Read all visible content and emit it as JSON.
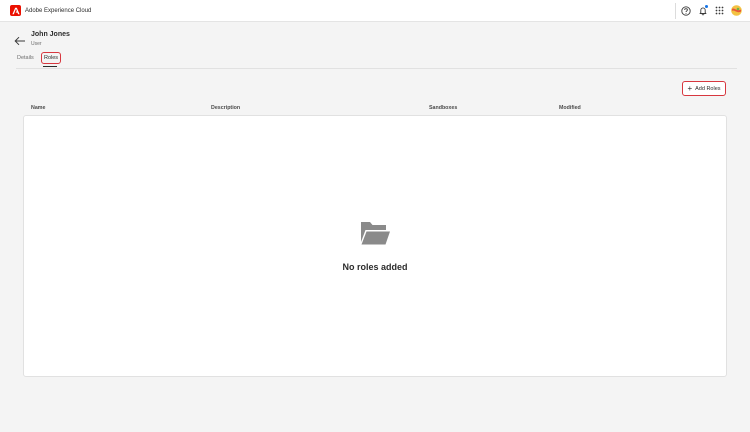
{
  "app": {
    "title": "Adobe Experience Cloud",
    "brand_color": "#eb1000"
  },
  "topbar": {
    "icons": [
      "help-icon",
      "bell-icon",
      "apps-icon",
      "avatar"
    ]
  },
  "user": {
    "name": "John Jones",
    "type": "User"
  },
  "tabs": [
    {
      "label": "Details",
      "active": false
    },
    {
      "label": "Roles",
      "active": true
    }
  ],
  "actions": {
    "add_roles_label": "Add Roles"
  },
  "table": {
    "columns": [
      "Name",
      "Description",
      "Sandboxes",
      "Modified"
    ],
    "rows": [],
    "empty_message": "No roles added"
  },
  "colors": {
    "highlight": "#d7373f",
    "accent": "#1473e6"
  }
}
